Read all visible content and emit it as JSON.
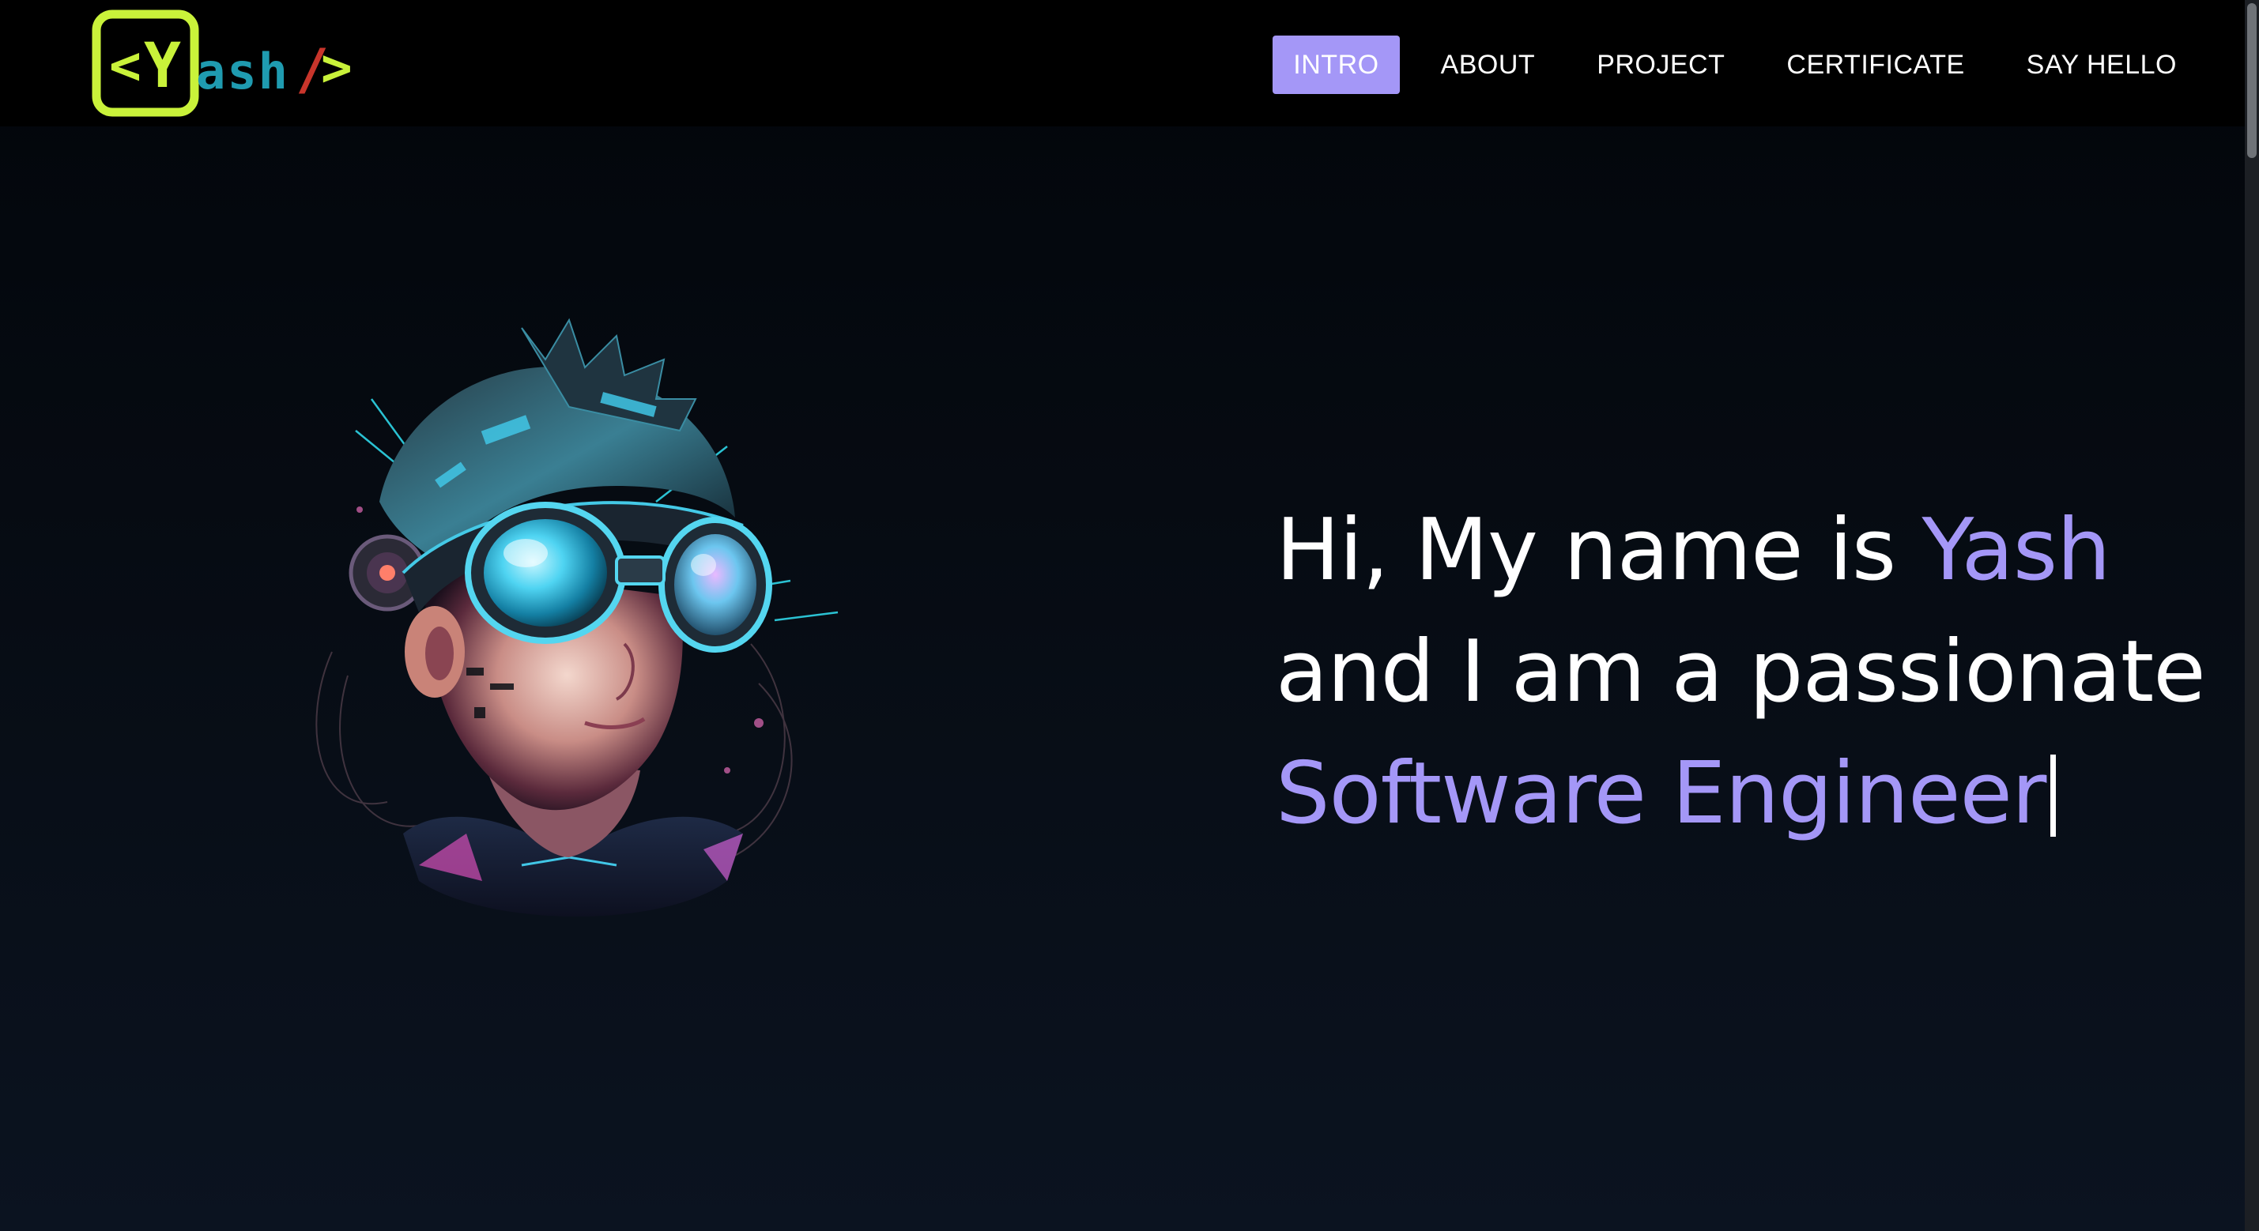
{
  "logo": {
    "open_bracket": "<",
    "letter": "Y",
    "rest": "ash",
    "slash": "/",
    "close_bracket": ">"
  },
  "nav": {
    "items": [
      {
        "label": "INTRO",
        "active": true
      },
      {
        "label": "ABOUT",
        "active": false
      },
      {
        "label": "PROJECT",
        "active": false
      },
      {
        "label": "CERTIFICATE",
        "active": false
      },
      {
        "label": "SAY HELLO",
        "active": false
      }
    ]
  },
  "hero": {
    "line1_prefix": "Hi, My name is ",
    "name": "Yash",
    "line2": "and I am a passionate",
    "role": "Software Engineer"
  },
  "colors": {
    "accent": "#a497f7",
    "logo_green": "#c9f23a",
    "logo_teal": "#1f9bb0",
    "logo_red": "#c8352b",
    "navbar_bg": "#000000",
    "page_bg": "#060b12"
  },
  "icons": {
    "hero_image": "cyberpunk-vr-avatar"
  }
}
